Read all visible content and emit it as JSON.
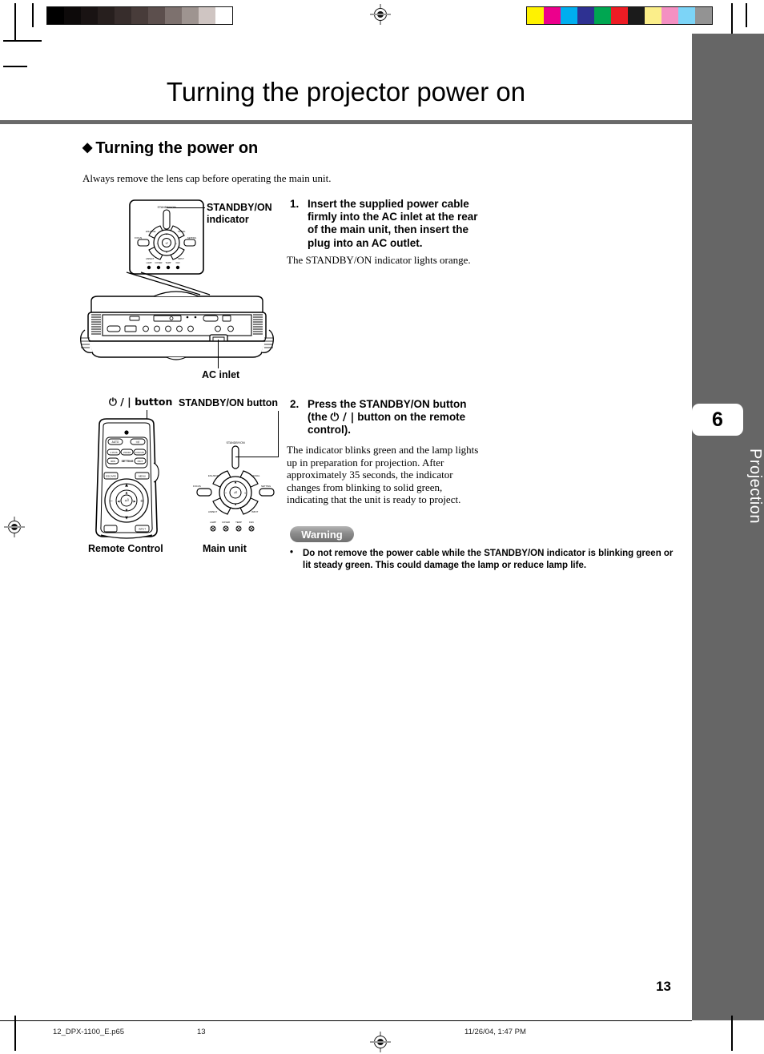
{
  "document": {
    "page_title": "Turning the projector power on",
    "section_heading": "Turning the power on",
    "section_bullet": "◆",
    "lead_text": "Always remove the lens cap before operating the main unit.",
    "page_number": "13"
  },
  "sidebar": {
    "chapter_number": "6",
    "chapter_name": "Projection",
    "background": "#666666"
  },
  "steps": [
    {
      "number": "1.",
      "instruction": "Insert the supplied power cable firmly into the AC inlet at the rear of the main unit, then insert the plug into an AC outlet.",
      "note": "The STANDBY/ON indicator lights orange."
    },
    {
      "number": "2.",
      "instruction_pre": "Press the STANDBY/ON button (the ",
      "instruction_symbol": "⏻ / |",
      "instruction_post": " button on the remote control).",
      "note": "The indicator blinks green and the lamp lights up in preparation for projection. After approximately 35 seconds, the indicator changes from blinking to solid green, indicating that the unit is ready to project."
    }
  ],
  "warning": {
    "label": "Warning",
    "bullet": "•",
    "text": "Do not remove the power cable while the STANDBY/ON indicator is blinking green or lit steady green. This could damage the lamp or reduce lamp life."
  },
  "figures": {
    "standby_indicator_label": "STANDBY/ON\nindicator",
    "standby_indicator_label_line1": "STANDBY/ON",
    "standby_indicator_label_line2": "indicator",
    "ac_inlet_label": "AC inlet",
    "power_button_label": "⏻ / | button",
    "standby_button_label": "STANDBY/ON button",
    "remote_caption": "Remote Control",
    "mainunit_caption": "Main unit",
    "panel_indicator_text": "STANDBY/ON",
    "panel_leds": [
      "LAMP",
      "COVER",
      "TEMP",
      "FAN"
    ],
    "panel_buttons": [
      "ENLARGE",
      "SIGNAL",
      "FOCUS",
      "SETTING",
      "ASPECT",
      "INPUT"
    ],
    "remote_buttons": [
      "AUTO",
      "⏻/I",
      "V POS",
      "ZOOM",
      "FOCUS",
      "IRIS",
      "SETTING",
      "PICT"
    ],
    "remote_nav_buttons": [
      "ESCAPE",
      "MENU",
      "INPUT"
    ]
  },
  "calibration": {
    "grayscale": [
      "#000000",
      "#0d0a0a",
      "#191313",
      "#271f1e",
      "#372d2c",
      "#483c3a",
      "#5c4f4d",
      "#7d716e",
      "#9e9490",
      "#cfc5c2",
      "#ffffff"
    ],
    "colors": [
      "#fff200",
      "#ec008c",
      "#00aeef",
      "#2e3192",
      "#00a651",
      "#ed1c24",
      "#1b1b1b",
      "#fbee8a",
      "#f490c2",
      "#7cd4f7",
      "#939393"
    ]
  },
  "footer": {
    "filename": "12_DPX-1100_E.p65",
    "page": "13",
    "timestamp": "11/26/04, 1:47 PM"
  }
}
